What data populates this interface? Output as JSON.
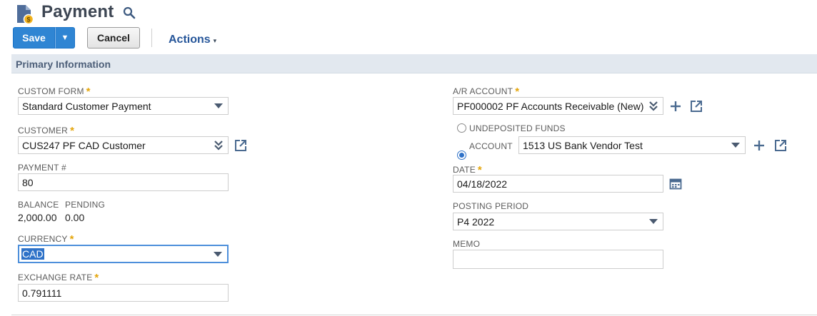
{
  "header": {
    "title": "Payment",
    "page_icon": "payment-document-icon",
    "search_icon": "search-icon"
  },
  "toolbar": {
    "save_label": "Save",
    "save_menu_glyph": "▼",
    "cancel_label": "Cancel",
    "actions_label": "Actions",
    "actions_caret": "▾"
  },
  "section": {
    "title": "Primary Information"
  },
  "left": {
    "custom_form": {
      "label": "CUSTOM FORM",
      "value": "Standard Customer Payment",
      "required": "*"
    },
    "customer": {
      "label": "CUSTOMER",
      "value": "CUS247 PF CAD Customer",
      "required": "*"
    },
    "payment_number": {
      "label": "PAYMENT #",
      "value": "80"
    },
    "balance": {
      "label": "BALANCE",
      "value": "2,000.00"
    },
    "pending": {
      "label": "PENDING",
      "value": "0.00"
    },
    "currency": {
      "label": "CURRENCY",
      "value": "CAD",
      "required": "*"
    },
    "exchange_rate": {
      "label": "EXCHANGE RATE",
      "value": "0.791111",
      "required": "*"
    }
  },
  "right": {
    "ar_account": {
      "label": "A/R ACCOUNT",
      "value": "PF000002 PF Accounts Receivable (New)",
      "required": "*"
    },
    "undeposited": {
      "label": "UNDEPOSITED FUNDS"
    },
    "account": {
      "label": "ACCOUNT",
      "value": "1513 US Bank Vendor Test"
    },
    "date": {
      "label": "DATE",
      "value": "04/18/2022",
      "required": "*"
    },
    "posting_period": {
      "label": "POSTING PERIOD",
      "value": "P4 2022"
    },
    "memo": {
      "label": "MEMO",
      "value": ""
    }
  },
  "colors": {
    "primary_button": "#2f85d3",
    "link": "#255599",
    "required_star": "#e4a50b",
    "section_bar": "#e2e8ef"
  }
}
